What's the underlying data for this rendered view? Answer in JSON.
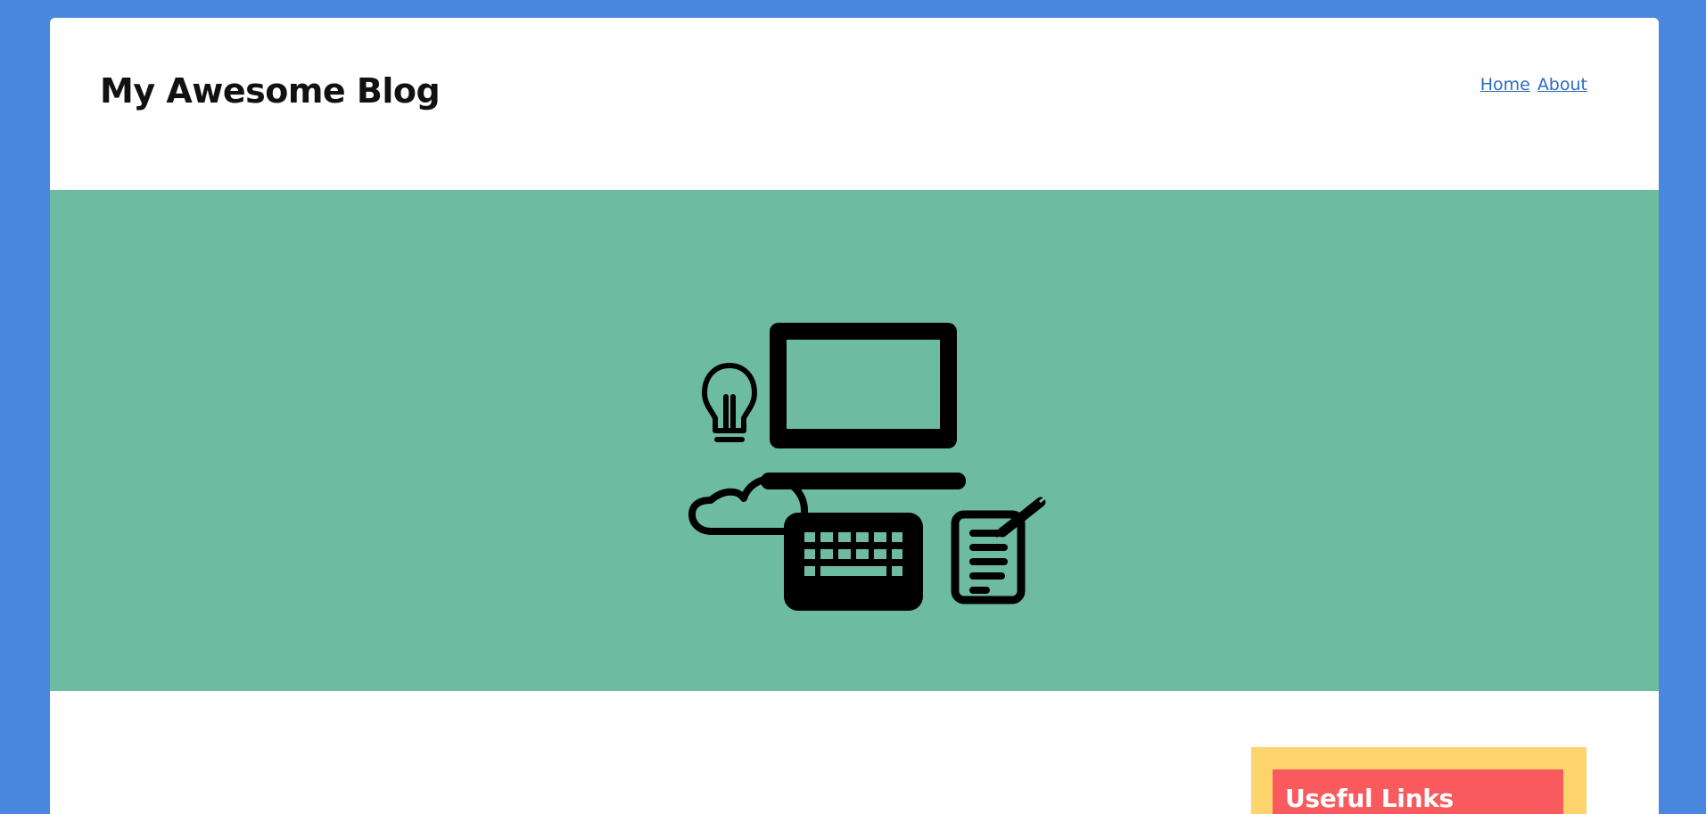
{
  "header": {
    "site_title": "My Awesome Blog",
    "nav": [
      {
        "label": "Home"
      },
      {
        "label": "About"
      }
    ]
  },
  "hero": {
    "icons": [
      "lightbulb-icon",
      "laptop-icon",
      "cloud-icon",
      "keyboard-icon",
      "notepad-pencil-icon"
    ]
  },
  "sidebar": {
    "widget_title": "Useful Links"
  },
  "colors": {
    "outer_background": "#4a88df",
    "hero_background": "#6dbca2",
    "widget_background": "#fdd36c",
    "widget_title_background": "#f85a5e",
    "link": "#2b6cc4"
  }
}
